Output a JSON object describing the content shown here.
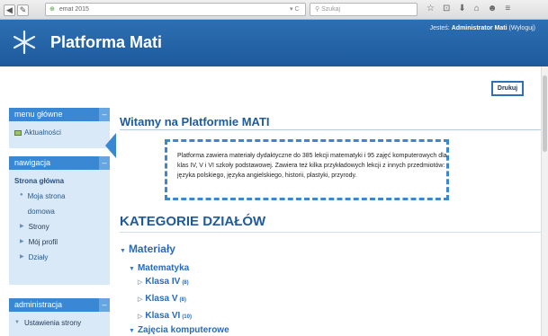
{
  "browser": {
    "url": "emat 2015",
    "search_placeholder": "Szukaj",
    "back_icon": "back-arrow-icon",
    "tools": [
      "☆",
      "⊡",
      "⬇",
      "⌂",
      "☻",
      "≡"
    ]
  },
  "header": {
    "title": "Platforma Mati",
    "login_prefix": "Jesteś:",
    "login_user": "Administrator Mati",
    "logout": "(Wyloguj)"
  },
  "print_button": "Drukuj",
  "sidebar": {
    "main_menu": {
      "title": "menu główne",
      "items": [
        "Aktualności"
      ]
    },
    "navigation": {
      "title": "nawigacja",
      "home": "Strona główna",
      "my_home": "Moja strona domowa",
      "pages": "Strony",
      "profile": "Mój profil",
      "sections": "Działy"
    },
    "administration": {
      "title": "administracja",
      "settings": "Ustawienia strony"
    }
  },
  "main": {
    "welcome_title": "Witamy na Platformie MATI",
    "intro": "Platforma zawiera materiały dydaktyczne do 385 lekcji matematyki i 95 zajęć komputerowych dla klas IV, V i VI szkoły podstawowej. Zawiera też kilka przykładowych lekcji z innych przedmiotów: języka polskiego, języka angielskiego, historii, plastyki, przyrody.",
    "categories_title": "KATEGORIE DZIAŁÓW",
    "tree": {
      "materials": "Materiały",
      "math": "Matematyka",
      "class4": "Klasa IV",
      "class4_count": "(8)",
      "class5": "Klasa V",
      "class5_count": "(8)",
      "class6": "Klasa VI",
      "class6_count": "(10)",
      "computer": "Zajęcia komputerowe"
    }
  },
  "colors": {
    "header": "#2d6fb3",
    "block_head": "#3a87d3",
    "block_body": "#d9e9f8",
    "title": "#1f5b9a"
  }
}
